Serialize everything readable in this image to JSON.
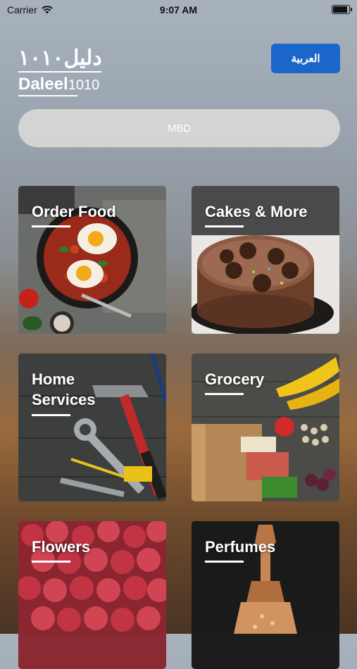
{
  "status_bar": {
    "carrier": "Carrier",
    "time": "9:07 AM",
    "battery_level": 1.0
  },
  "header": {
    "logo_arabic": "دليل١٠١٠",
    "logo_english": "Daleel",
    "logo_number": "1010",
    "language_button": "العربية"
  },
  "location": {
    "value": "MBD"
  },
  "categories": [
    {
      "title": "Order Food"
    },
    {
      "title": "Cakes & More"
    },
    {
      "title": "Home Services"
    },
    {
      "title": "Grocery"
    },
    {
      "title": "Flowers"
    },
    {
      "title": "Perfumes"
    }
  ],
  "colors": {
    "accent_button": "#1b67c9",
    "text_light": "#ffffff"
  }
}
